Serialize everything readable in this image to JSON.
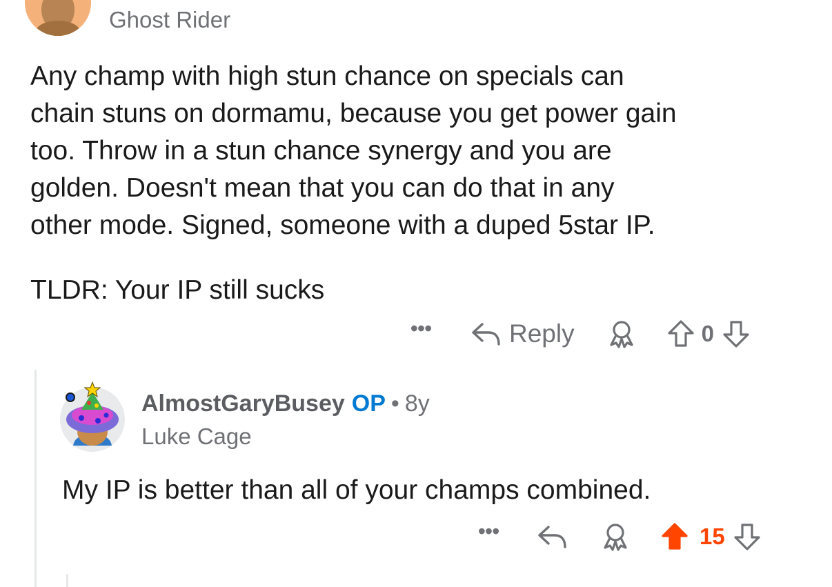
{
  "parent_comment": {
    "flair": "Ghost Rider",
    "body": [
      "Any champ with high stun chance on specials can\nchain stuns on dormamu, because you get power gain\ntoo.  Throw in a stun chance synergy and you are\ngolden.  Doesn't mean that you can do that in any\nother mode.  Signed, someone with a duped 5star IP.",
      "TLDR: Your IP still sucks"
    ],
    "actions": {
      "more_label": "•••",
      "reply_label": "Reply",
      "vote_count": "0"
    }
  },
  "reply_comment": {
    "username": "AlmostGaryBusey",
    "op_badge": "OP",
    "separator": "•",
    "age": "8y",
    "flair": "Luke Cage",
    "body": "My IP is better than all of your champs combined.",
    "actions": {
      "more_label": "•••",
      "vote_count": "15",
      "upvoted": true
    }
  },
  "colors": {
    "text": "#1a1a1b",
    "meta": "#6f7175",
    "op_blue": "#0079d3",
    "upvote_orange": "#ff4500",
    "thread_line": "#e6e7e8"
  },
  "icons": {
    "reply": "reply-arrow-icon",
    "award": "award-icon",
    "upvote": "upvote-arrow-icon",
    "downvote": "downvote-arrow-icon",
    "more": "more-dots-icon"
  }
}
